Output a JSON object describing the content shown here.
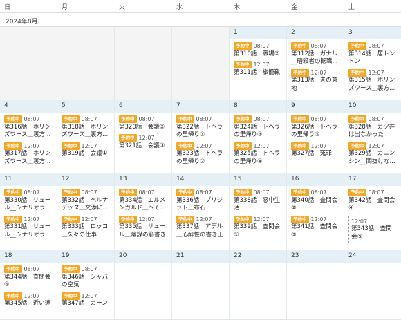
{
  "weekdays": [
    "日",
    "月",
    "火",
    "水",
    "木",
    "金",
    "土"
  ],
  "month_label": "2024年8月",
  "badge_label": "予約中",
  "weeks": [
    [
      {
        "day": "",
        "events": []
      },
      {
        "day": "",
        "events": []
      },
      {
        "day": "",
        "events": []
      },
      {
        "day": "",
        "events": []
      },
      {
        "day": "1",
        "events": [
          {
            "badge": true,
            "time": "08:07",
            "title": "第310話　職場②"
          },
          {
            "badge": true,
            "time": "12:07",
            "title": "第311話　旅籠靴"
          }
        ]
      },
      {
        "day": "2",
        "events": [
          {
            "badge": true,
            "time": "08:07",
            "title": "第312話　ガナル__暗殺者の転職..."
          },
          {
            "badge": true,
            "time": "12:07",
            "title": "第313話　夫の意地"
          }
        ]
      },
      {
        "day": "3",
        "events": [
          {
            "badge": true,
            "time": "08:07",
            "title": "第314話　居トントン"
          },
          {
            "badge": true,
            "time": "12:07",
            "title": "第315話　ホリンズワース＿裏方..."
          }
        ]
      }
    ],
    [
      {
        "day": "4",
        "events": [
          {
            "badge": true,
            "time": "08:07",
            "title": "第316話　ホリンズワース＿裏方..."
          },
          {
            "badge": true,
            "time": "12:07",
            "title": "第317話　ホリンズワース＿裏方..."
          }
        ]
      },
      {
        "day": "5",
        "events": [
          {
            "badge": true,
            "time": "08:07",
            "title": "第318話　ホリンズワース＿裏方..."
          },
          {
            "badge": true,
            "time": "12:07",
            "title": "第319話　会議①"
          }
        ]
      },
      {
        "day": "6",
        "events": [
          {
            "badge": true,
            "time": "08:07",
            "title": "第320話　会議②"
          },
          {
            "badge": true,
            "time": "12:07",
            "title": "第321話　会議③"
          }
        ]
      },
      {
        "day": "7",
        "events": [
          {
            "badge": true,
            "time": "08:07",
            "title": "第322話　トヘラの里帰り①"
          },
          {
            "badge": true,
            "time": "12:07",
            "title": "第323話　トヘラの里帰り②"
          }
        ]
      },
      {
        "day": "8",
        "events": [
          {
            "badge": true,
            "time": "08:07",
            "title": "第324話　トヘラの里帰り③"
          },
          {
            "badge": true,
            "time": "12:07",
            "title": "第325話　トヘラの里帰り④"
          }
        ]
      },
      {
        "day": "9",
        "events": [
          {
            "badge": true,
            "time": "08:07",
            "title": "第326話　トヘラの里帰り⑤"
          },
          {
            "badge": true,
            "time": "12:07",
            "title": "第327話　冤罪"
          }
        ]
      },
      {
        "day": "10",
        "events": [
          {
            "badge": true,
            "time": "08:07",
            "title": "第328話　カツ丼は出なかった"
          },
          {
            "badge": true,
            "time": "12:07",
            "title": "第329話　カニンシン__関抜けな..."
          }
        ]
      }
    ],
    [
      {
        "day": "11",
        "events": [
          {
            "badge": true,
            "time": "08:07",
            "title": "第330話　リュール__シナリオラ..."
          },
          {
            "badge": true,
            "time": "12:07",
            "title": "第331話　リュール__シナリオラ..."
          }
        ]
      },
      {
        "day": "12",
        "events": [
          {
            "badge": true,
            "time": "08:07",
            "title": "第332話　ペルナデッタ＿交渉に..."
          },
          {
            "badge": true,
            "time": "12:07",
            "title": "第333話　ロッコ＿久々の仕事"
          }
        ]
      },
      {
        "day": "13",
        "events": [
          {
            "badge": true,
            "time": "08:07",
            "title": "第334話　エルメンガルド＿へそ..."
          },
          {
            "badge": true,
            "time": "12:07",
            "title": "第335話　リュール＿陰謀の筋書き"
          }
        ]
      },
      {
        "day": "14",
        "events": [
          {
            "badge": true,
            "time": "08:07",
            "title": "第336話　プリジット＿布石"
          },
          {
            "badge": true,
            "time": "12:07",
            "title": "第337話　アデル＿心酔性の書き王"
          }
        ]
      },
      {
        "day": "15",
        "events": [
          {
            "badge": true,
            "time": "08:07",
            "title": "第338話　窓中生活"
          },
          {
            "badge": true,
            "time": "12:07",
            "title": "第339話　査問会①"
          }
        ]
      },
      {
        "day": "16",
        "events": [
          {
            "badge": true,
            "time": "08:07",
            "title": "第340話　査問会②"
          },
          {
            "badge": true,
            "time": "12:07",
            "title": "第341話　査問会③"
          }
        ]
      },
      {
        "day": "17",
        "events": [
          {
            "badge": true,
            "time": "08:07",
            "title": "第342話　査問会④"
          },
          {
            "badge": false,
            "time": "12:07",
            "title": "第343話　査問会⑤",
            "boxed": true
          }
        ]
      }
    ],
    [
      {
        "day": "18",
        "events": [
          {
            "badge": true,
            "time": "08:07",
            "title": "第344話　査問会⑥"
          },
          {
            "badge": true,
            "time": "12:07",
            "title": "第345話　近い速"
          }
        ]
      },
      {
        "day": "19",
        "events": [
          {
            "badge": true,
            "time": "08:07",
            "title": "第346話　シャバの空気"
          },
          {
            "badge": true,
            "time": "12:07",
            "title": "第347話　カーン"
          }
        ]
      },
      {
        "day": "20",
        "events": []
      },
      {
        "day": "21",
        "events": []
      },
      {
        "day": "22",
        "events": []
      },
      {
        "day": "23",
        "events": []
      },
      {
        "day": "24",
        "events": []
      }
    ]
  ]
}
